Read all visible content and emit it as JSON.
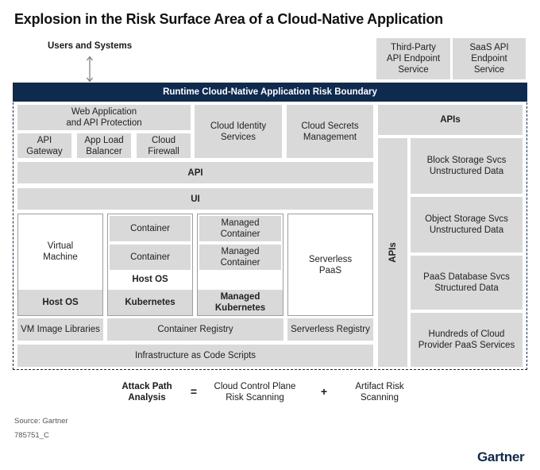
{
  "title": "Explosion in the Risk Surface Area of a Cloud-Native Application",
  "users_label": "Users and Systems",
  "external": {
    "third_party": "Third-Party\nAPI Endpoint\nService",
    "saas": "SaaS API\nEndpoint\nService"
  },
  "boundary_title": "Runtime Cloud-Native Application Risk Boundary",
  "left": {
    "waap": "Web Application\nand API Protection",
    "api_gateway": "API\nGateway",
    "app_load_balancer": "App Load\nBalancer",
    "cloud_firewall": "Cloud\nFirewall",
    "cloud_identity": "Cloud Identity\nServices",
    "cloud_secrets": "Cloud Secrets\nManagement",
    "api_bar": "API",
    "ui_bar": "UI",
    "virtual_machine": "Virtual\nMachine",
    "host_os_1": "Host OS",
    "container_1": "Container",
    "container_2": "Container",
    "host_os_2": "Host OS",
    "kubernetes": "Kubernetes",
    "managed_container_1": "Managed\nContainer",
    "managed_container_2": "Managed\nContainer",
    "managed_kubernetes": "Managed\nKubernetes",
    "serverless_paas": "Serverless\nPaaS",
    "vm_image_libraries": "VM Image Libraries",
    "container_registry": "Container Registry",
    "serverless_registry": "Serverless Registry",
    "iac_scripts": "Infrastructure as Code Scripts"
  },
  "right": {
    "apis_top": "APIs",
    "apis_vertical": "APIs",
    "block_storage": "Block Storage Svcs\nUnstructured Data",
    "object_storage": "Object Storage Svcs\nUnstructured Data",
    "paas_database": "PaaS Database Svcs\nStructured Data",
    "hundreds_paas": "Hundreds of Cloud\nProvider PaaS Services"
  },
  "formula": {
    "term": "Attack Path\nAnalysis",
    "equals": "=",
    "part1": "Cloud Control Plane\nRisk Scanning",
    "plus": "+",
    "part2": "Artifact Risk\nScanning"
  },
  "footer": {
    "source": "Source: Gartner",
    "id": "785751_C",
    "logo": "Gartner"
  }
}
